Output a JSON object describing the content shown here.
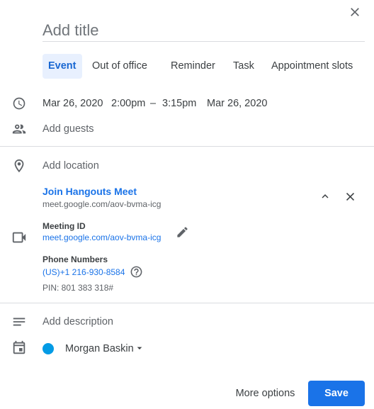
{
  "title_input": {
    "placeholder": "Add title"
  },
  "tabs": [
    {
      "label": "Event",
      "active": true
    },
    {
      "label": "Out of office"
    },
    {
      "label": "Reminder"
    },
    {
      "label": "Task"
    },
    {
      "label": "Appointment slots"
    }
  ],
  "datetime": {
    "start_date": "Mar 26, 2020",
    "start_time": "2:00pm",
    "separator": "–",
    "end_time": "3:15pm",
    "end_date": "Mar 26, 2020"
  },
  "guests": {
    "placeholder": "Add guests"
  },
  "location": {
    "placeholder": "Add location"
  },
  "conference": {
    "join_label": "Join Hangouts Meet",
    "join_url": "meet.google.com/aov-bvma-icg",
    "meeting_id_label": "Meeting ID",
    "meeting_id_value": "meet.google.com/aov-bvma-icg",
    "phone_label": "Phone Numbers",
    "phone_number": "(US)+1 216-930-8584",
    "pin": "PIN: 801 383 318#"
  },
  "description": {
    "placeholder": "Add description"
  },
  "calendar": {
    "owner": "Morgan Baskin",
    "color": "#039be5"
  },
  "footer": {
    "more_options": "More options",
    "save": "Save"
  },
  "colors": {
    "accent": "#1a73e8",
    "tab_active_bg": "#e8f0fe",
    "divider": "#dadce0"
  },
  "icons": [
    "close-icon",
    "clock-icon",
    "people-icon",
    "location-pin-icon",
    "video-camera-icon",
    "chevron-up-icon",
    "close-icon",
    "pencil-icon",
    "help-circle-icon",
    "description-lines-icon",
    "calendar-icon",
    "dropdown-arrow-icon"
  ]
}
